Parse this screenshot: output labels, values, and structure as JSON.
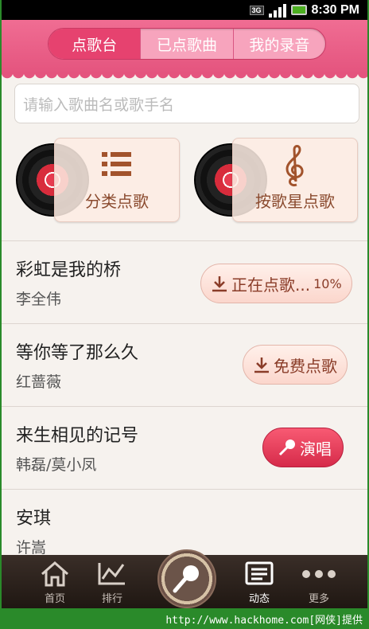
{
  "status_bar": {
    "network": "3G",
    "time": "8:30 PM"
  },
  "tabs": [
    {
      "label": "点歌台",
      "active": true
    },
    {
      "label": "已点歌曲",
      "active": false
    },
    {
      "label": "我的录音",
      "active": false
    }
  ],
  "search": {
    "placeholder": "请输入歌曲名或歌手名"
  },
  "categories": [
    {
      "label": "分类点歌",
      "icon": "list-icon"
    },
    {
      "label": "按歌星点歌",
      "icon": "treble-clef-icon"
    }
  ],
  "songs": [
    {
      "title": "彩虹是我的桥",
      "artist": "李全伟",
      "action": "正在点歌...",
      "progress": "10%"
    },
    {
      "title": "等你等了那么久",
      "artist": "红蔷薇",
      "action": "免费点歌"
    },
    {
      "title": "来生相见的记号",
      "artist": "韩磊/莫小凤",
      "action": "演唱"
    },
    {
      "title": "安琪",
      "artist": "许嵩"
    }
  ],
  "bottom_nav": [
    {
      "label": "首页",
      "icon": "home-icon"
    },
    {
      "label": "排行",
      "icon": "chart-icon"
    },
    {
      "label": "",
      "icon": "microphone-icon"
    },
    {
      "label": "动态",
      "icon": "news-icon",
      "active": true
    },
    {
      "label": "更多",
      "icon": "more-icon"
    }
  ],
  "watermark": "http://www.hackhome.com[网侠]提供",
  "colors": {
    "header_pink": "#e4547e",
    "tab_active": "#e6426f",
    "sing_button": "#d62b4a",
    "download_text": "#8a3c28"
  }
}
